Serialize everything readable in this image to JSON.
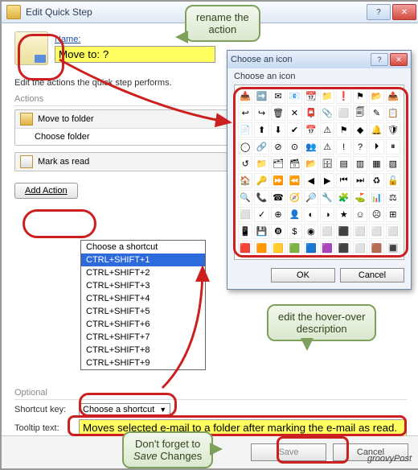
{
  "window": {
    "title": "Edit Quick Step",
    "help_glyph": "?",
    "close_glyph": "✕"
  },
  "name": {
    "label": "Name:",
    "value": "Move to: ?"
  },
  "desc": "Edit the actions the quick step performs.",
  "actions_header": "Actions",
  "actions": [
    {
      "label": "Move to folder",
      "sub": "Choose folder"
    },
    {
      "label": "Mark as read"
    }
  ],
  "add_action": "Add Action",
  "optional_header": "Optional",
  "shortcut": {
    "label": "Shortcut key:",
    "selected": "Choose a shortcut",
    "options": [
      "Choose a shortcut",
      "CTRL+SHIFT+1",
      "CTRL+SHIFT+2",
      "CTRL+SHIFT+3",
      "CTRL+SHIFT+4",
      "CTRL+SHIFT+5",
      "CTRL+SHIFT+6",
      "CTRL+SHIFT+7",
      "CTRL+SHIFT+8",
      "CTRL+SHIFT+9"
    ],
    "highlighted_index": 1
  },
  "tooltip": {
    "label": "Tooltip text:",
    "value": "Moves selected e-mail to a folder after marking the e-mail as read."
  },
  "footer": {
    "save": "Save",
    "cancel": "Cancel"
  },
  "logo": "groovyPost",
  "picker": {
    "title": "Choose an icon",
    "label": "Choose an icon",
    "ok": "OK",
    "cancel": "Cancel",
    "rows": 10,
    "cols": 10,
    "icons": [
      [
        "📥",
        "➡️",
        "✉",
        "📧",
        "📆",
        "📁",
        "❗",
        "⚑",
        "📂",
        "📤"
      ],
      [
        "↩",
        "↪",
        "🗑",
        "✕",
        "📮",
        "📎",
        "⬜",
        "🗐",
        "✎",
        "📋"
      ],
      [
        "📄",
        "⬆",
        "⬇",
        "✔",
        "📅",
        "⚠",
        "⚑",
        "◆",
        "🔔",
        "🛡"
      ],
      [
        "◯",
        "🔗",
        "⊘",
        "⊙",
        "👥",
        "⚠",
        "!",
        "?",
        "⏵",
        "⏸"
      ],
      [
        "↺",
        "📁",
        "🗂",
        "🗃",
        "📂",
        "🗄",
        "▤",
        "▥",
        "▦",
        "▧"
      ],
      [
        "🏠",
        "🔑",
        "⏩",
        "⏪",
        "◀",
        "▶",
        "⏮",
        "⏭",
        "♻",
        "🔓"
      ],
      [
        "🔍",
        "📞",
        "☎",
        "🧭",
        "🔎",
        "🔧",
        "🧩",
        "⛳",
        "📊",
        "⚖"
      ],
      [
        "⬜",
        "✓",
        "⊕",
        "👤",
        "◐",
        "◑",
        "★",
        "☺",
        "☹",
        "⊞"
      ],
      [
        "📱",
        "💾",
        "❽",
        "$",
        "◉",
        "⬜",
        "⬛",
        "⬜",
        "⬜",
        "⬜"
      ],
      [
        "🟥",
        "🟧",
        "🟨",
        "🟩",
        "🟦",
        "🟪",
        "⬛",
        "⬜",
        "🟫",
        "🔳"
      ]
    ]
  },
  "callouts": {
    "c1": "rename the\naction",
    "c2": "edit the hover-over\ndescription",
    "c3_a": "Don't forget to",
    "c3_b": "Save",
    "c3_c": " Changes"
  }
}
